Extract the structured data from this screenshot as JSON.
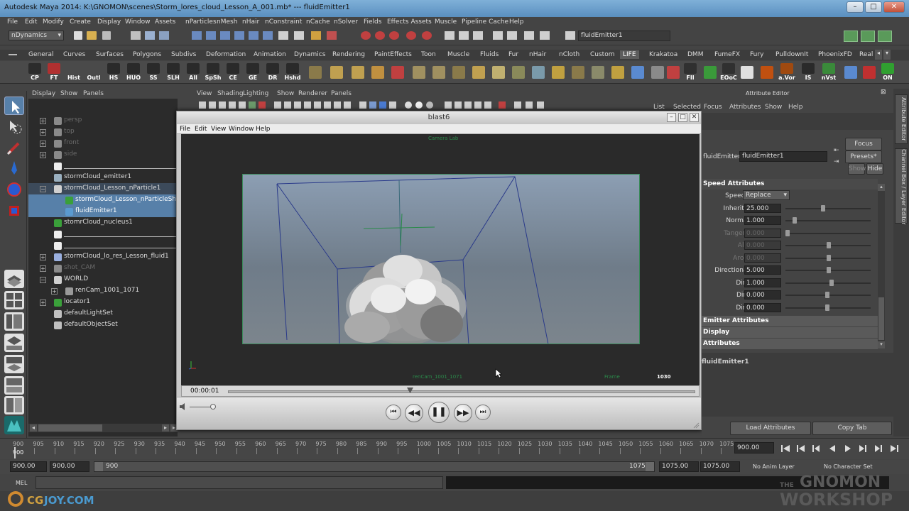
{
  "window": {
    "title": "Autodesk Maya 2014: K:\\GNOMON\\scenes\\Storm_lores_cloud_Lesson_A_001.mb*   ---   fluidEmitter1"
  },
  "menubar": [
    "File",
    "Edit",
    "Modify",
    "Create",
    "Display",
    "Window",
    "Assets",
    "nParticles",
    "nMesh",
    "nHair",
    "nConstraint",
    "nCache",
    "nSolver",
    "Fields",
    "Effects Assets",
    "Muscle",
    "Pipeline Cache",
    "Help"
  ],
  "statusline": {
    "menuset": "nDynamics",
    "selected_field": "fluidEmitter1"
  },
  "shelf": {
    "tabs": [
      "General",
      "Curves",
      "Surfaces",
      "Polygons",
      "Subdivs",
      "Deformation",
      "Animation",
      "Dynamics",
      "Rendering",
      "PaintEffects",
      "Toon",
      "Muscle",
      "Fluids",
      "Fur",
      "nHair",
      "nCloth",
      "Custom",
      "LIFE",
      "Krakatoa",
      "DMM",
      "FumeFX",
      "Fury",
      "PulldownIt",
      "PhoenixFD",
      "Real"
    ],
    "active_tab": "LIFE",
    "buttons": [
      "CP",
      "FT",
      "Hist",
      "Outl",
      "HS",
      "HUO",
      "SS",
      "SLH",
      "All",
      "SpSh",
      "CE",
      "GE",
      "DR",
      "Hshd",
      "FIl",
      "EOoC",
      "a.Vor",
      "IS",
      "nVst",
      "ON"
    ]
  },
  "outliner": {
    "menu": [
      "Display",
      "Show",
      "Panels"
    ],
    "items": [
      {
        "label": "persp",
        "state": "grey"
      },
      {
        "label": "top",
        "state": "grey"
      },
      {
        "label": "front",
        "state": "grey"
      },
      {
        "label": "side",
        "state": "grey"
      },
      {
        "label": "",
        "state": "normal"
      },
      {
        "label": "stormCloud_emitter1",
        "state": "normal"
      },
      {
        "label": "stormCloud_Lesson_nParticle1",
        "state": "highlight"
      },
      {
        "label": "stormCloud_Lesson_nParticleShape1",
        "state": "selected"
      },
      {
        "label": "fluidEmitter1",
        "state": "selected"
      },
      {
        "label": "stomrCloud_nucleus1",
        "state": "normal"
      },
      {
        "label": "",
        "state": "normal"
      },
      {
        "label": "",
        "state": "normal"
      },
      {
        "label": "stormCloud_lo_res_Lesson_fluid1",
        "state": "normal"
      },
      {
        "label": "shot_CAM",
        "state": "grey"
      },
      {
        "label": "WORLD",
        "state": "normal"
      },
      {
        "label": "renCam_1001_1071",
        "state": "normal"
      },
      {
        "label": "locator1",
        "state": "normal"
      },
      {
        "label": "defaultLightSet",
        "state": "normal"
      },
      {
        "label": "defaultObjectSet",
        "state": "normal"
      }
    ]
  },
  "viewport": {
    "menu": [
      "View",
      "Shading",
      "Lighting",
      "Show",
      "Renderer",
      "Panels"
    ]
  },
  "blast": {
    "title": "blast6",
    "menu": [
      "File",
      "Edit",
      "View",
      "Window",
      "Help"
    ],
    "time": "00:00:01",
    "hud_top": "Camera Lab",
    "hud_cam": "renCam_1001_1071",
    "hud_frame_label": "Frame",
    "hud_frame": "1030"
  },
  "attribute_editor": {
    "title": "Attribute Editor",
    "menu": [
      "List",
      "Selected",
      "Focus",
      "Attributes",
      "Show",
      "Help"
    ],
    "node_label": "fluidEmitter:",
    "node_value": "fluidEmitter1",
    "buttons": {
      "focus": "Focus",
      "presets": "Presets*",
      "show": "Show",
      "hide": "Hide",
      "load": "Load Attributes",
      "copy": "Copy Tab"
    },
    "section": "Speed Attributes",
    "rows": [
      {
        "label": "Speed Method",
        "value": "Replace",
        "dim": false
      },
      {
        "label": "Inherit Velocity",
        "value": "25.000",
        "dim": false
      },
      {
        "label": "Normal Speed",
        "value": "1.000",
        "dim": false
      },
      {
        "label": "Tangent Speed",
        "value": "0.000",
        "dim": true
      },
      {
        "label": "Along Axis",
        "value": "0.000",
        "dim": true
      },
      {
        "label": "Around Axis",
        "value": "0.000",
        "dim": true
      },
      {
        "label": "Directional Speed",
        "value": "5.000",
        "dim": false
      },
      {
        "label": "Direction X",
        "value": "1.000",
        "dim": false
      },
      {
        "label": "Direction Y",
        "value": "0.000",
        "dim": false
      },
      {
        "label": "Direction Z",
        "value": "0.000",
        "dim": false
      }
    ],
    "frames": [
      "Emitter Attributes",
      "Display",
      "Attributes"
    ],
    "footer_node": "fluidEmitter1"
  },
  "side_tabs": [
    "Attribute Editor",
    "Channel Box / Layer Editor"
  ],
  "time_slider": {
    "ticks": [
      "900",
      "905",
      "910",
      "915",
      "920",
      "925",
      "930",
      "935",
      "940",
      "945",
      "950",
      "955",
      "960",
      "965",
      "970",
      "975",
      "980",
      "985",
      "990",
      "995",
      "1000",
      "1005",
      "1010",
      "1015",
      "1020",
      "1025",
      "1030",
      "1035",
      "1040",
      "1045",
      "1050",
      "1055",
      "1060",
      "1065",
      "1070",
      "1075"
    ],
    "current": "900.00"
  },
  "range_slider": {
    "start": "900.00",
    "inner_start": "900.00",
    "range_start": "900",
    "range_end": "1075",
    "inner_end": "1075.00",
    "end": "1075.00",
    "anim_layer": "No Anim Layer",
    "char_set": "No Character Set"
  },
  "cmdline": {
    "label": "MEL"
  },
  "watermark": {
    "brand": "THE GNOMON WORKSHOP",
    "logo": "CGJOY.COM"
  }
}
